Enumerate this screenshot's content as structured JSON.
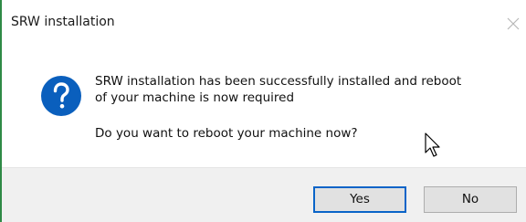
{
  "window": {
    "title": "SRW installation"
  },
  "message": {
    "line1": "SRW installation has been successfully installed and reboot",
    "line2": "of your machine is now required",
    "question": "Do you want to reboot your machine now?"
  },
  "icons": {
    "dialog_icon": "question-icon",
    "close_icon": "close-icon",
    "pointer": "mouse-cursor-icon"
  },
  "buttons": {
    "yes_label": "Yes",
    "no_label": "No"
  },
  "colors": {
    "icon_blue": "#0a5fbd",
    "default_button_border": "#0a64c8",
    "footer_bg": "#f0f0f0"
  }
}
